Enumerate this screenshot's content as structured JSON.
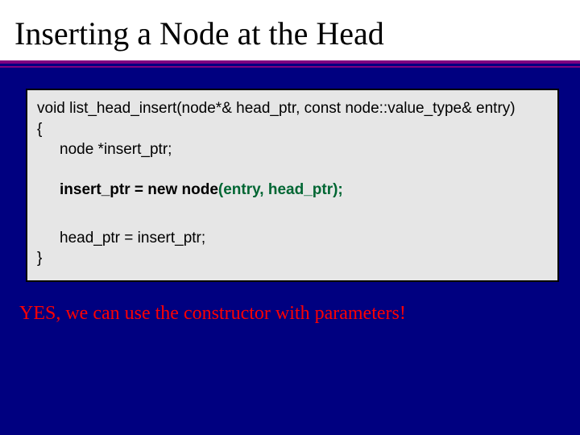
{
  "title": "Inserting a Node at the Head",
  "code": {
    "sig": "void list_head_insert(node*& head_ptr, const node::value_type& entry)",
    "open": "{",
    "decl": "node *insert_ptr;",
    "assign_pre": "insert_ptr = new node",
    "assign_paren_open": "(",
    "assign_args": "entry, head_ptr",
    "assign_paren_close": ");",
    "ret": "head_ptr = insert_ptr;",
    "close": "}"
  },
  "note": "YES, we can use the constructor with parameters!"
}
